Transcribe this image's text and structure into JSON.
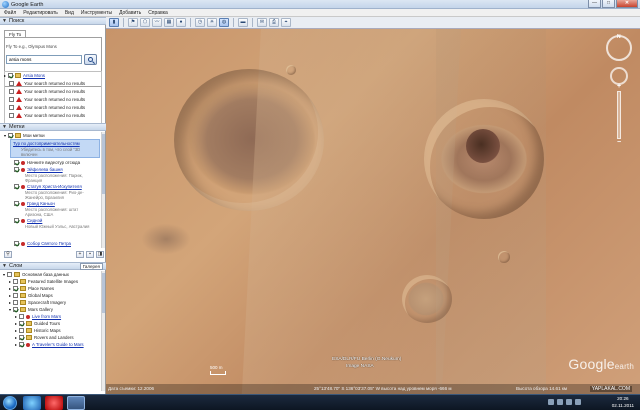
{
  "window": {
    "title": "Google Earth",
    "minimize": "—",
    "maximize": "□",
    "close": "✕"
  },
  "menu": [
    "Файл",
    "Редактировать",
    "Вид",
    "Инструменты",
    "Добавить",
    "Справка"
  ],
  "search": {
    "header": "Поиск",
    "tab": "Fly To",
    "hint": "Fly To e.g., Olympus Mons",
    "value": "arsia mons",
    "results": [
      {
        "label": "Arsia Mons",
        "type": "folder"
      },
      {
        "label": "Your search returned no results",
        "type": "warn"
      },
      {
        "label": "Your search returned no results",
        "type": "warn"
      },
      {
        "label": "Your search returned no results",
        "type": "warn"
      },
      {
        "label": "Your search returned no results",
        "type": "warn"
      },
      {
        "label": "Your search returned no results",
        "type": "warn"
      }
    ]
  },
  "places": {
    "header": "Метки",
    "root": "Мои метки",
    "tour_title": "Тур по достопримечательностям",
    "tour_sub1": "Убедитесь в том, что слой \"3D",
    "tour_sub2": "включен",
    "items": [
      {
        "label": "Начните видеотур отсюда",
        "sub1": "",
        "sub2": ""
      },
      {
        "label": "Эйфелева башня",
        "sub1": "Место расположения: Париж,",
        "sub2": "Франция"
      },
      {
        "label": "Статуя Христа-Искупителя",
        "sub1": "Место расположения: Рио-де-",
        "sub2": "Жанейро, Бразилия"
      },
      {
        "label": "Гранд Каньон",
        "sub1": "Место расположения: штат",
        "sub2": "Аризона, США"
      },
      {
        "label": "Сиднэй",
        "sub1": "Новый Южный Уэльс, Австралия",
        "sub2": ""
      },
      {
        "label": "Собор Святого Петра",
        "sub1": "",
        "sub2": ""
      }
    ]
  },
  "layers": {
    "header": "Слои",
    "gallery_tab": "Галерея",
    "items": [
      {
        "label": "Основная база данных",
        "level": 0,
        "link": false
      },
      {
        "label": "Featured Satellite Images",
        "level": 1,
        "link": false
      },
      {
        "label": "Place Names",
        "level": 1,
        "link": false
      },
      {
        "label": "Global Maps",
        "level": 1,
        "link": false
      },
      {
        "label": "Spacecraft Imagery",
        "level": 1,
        "link": false
      },
      {
        "label": "Mars Gallery",
        "level": 1,
        "link": false
      },
      {
        "label": "Live from Mars",
        "level": 2,
        "link": true
      },
      {
        "label": "Guided Tours",
        "level": 2,
        "link": false
      },
      {
        "label": "Historic Maps",
        "level": 2,
        "link": false
      },
      {
        "label": "Rovers and Landers",
        "level": 2,
        "link": false
      },
      {
        "label": "A Traveler's Guide to Mars",
        "level": 2,
        "link": true
      }
    ]
  },
  "map": {
    "credit1": "ESA/DLR/FU Berlin (G.Neukum)",
    "credit2": "Image NASA",
    "brand": "Google",
    "brand_small": "earth",
    "scale": "500 m",
    "status_left": "Дата съемки: 12.2006",
    "status_mid": "25°13'48.70\" S 136°03'37.05\" W высота над уровнем моря -666 м",
    "status_right": "Высота обзора 14.61 км",
    "north": "N"
  },
  "taskbar": {
    "time": "20:26",
    "date": "02.11.2011",
    "watermark": "YAPLAKAL.COM"
  }
}
